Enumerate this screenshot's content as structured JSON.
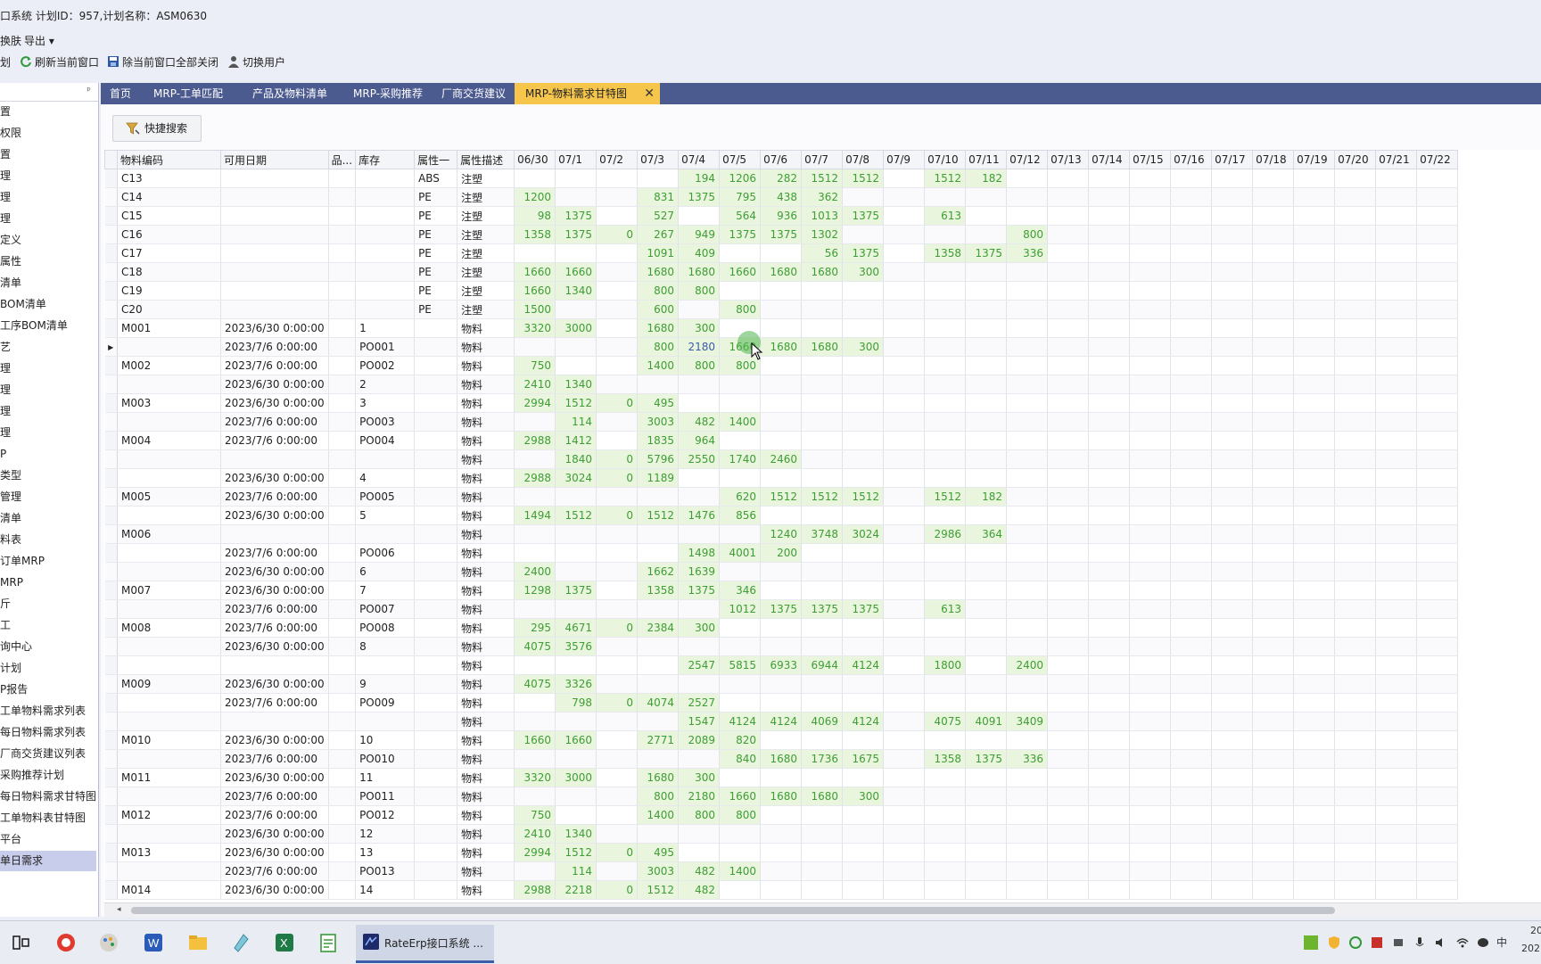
{
  "window": {
    "title": "口系统 计划ID：957,计划名称：ASM0630"
  },
  "menu": [
    "换肤",
    "导出 ▾"
  ],
  "toolbar": [
    {
      "label": "划",
      "icon": ""
    },
    {
      "label": "刷新当前窗口",
      "icon": "refresh-icon"
    },
    {
      "label": "除当前窗口全部关闭",
      "icon": "save-disk-icon"
    },
    {
      "label": "切换用户",
      "icon": "user-icon"
    }
  ],
  "sidebar": {
    "pin": "ᵖ",
    "items": [
      "置",
      "权限",
      "置",
      "理",
      "理",
      "理",
      "定义",
      "属性",
      "清单",
      "BOM清单",
      "工序BOM清单",
      "艺",
      "理",
      "理",
      "理",
      "理",
      "P",
      "类型",
      "管理",
      "清单",
      "料表",
      "订单MRP",
      "MRP",
      "斤",
      "工",
      "询中心",
      "计划",
      "P报告",
      "工单物料需求列表",
      "每日物料需求列表",
      "厂商交货建议列表",
      "采购推荐计划",
      "每日物料需求甘特图",
      "工单物料表甘特图",
      "平台",
      "单日需求"
    ],
    "selected_index": 35
  },
  "tabs": [
    "首页",
    "MRP-工单匹配",
    "产品及物料清单",
    "MRP-采购推荐",
    "厂商交货建议",
    "MRP-物料需求甘特图"
  ],
  "active_tab": 5,
  "quick_search": {
    "label": "快捷搜索"
  },
  "grid": {
    "columns": [
      "物料编码",
      "可用日期",
      "品...",
      "库存",
      "属性一",
      "属性描述",
      "06/30",
      "07/1",
      "07/2",
      "07/3",
      "07/4",
      "07/5",
      "07/6",
      "07/7",
      "07/8",
      "07/9",
      "07/10",
      "07/11",
      "07/12",
      "07/13",
      "07/14",
      "07/15",
      "07/16",
      "07/17",
      "07/18",
      "07/19",
      "07/20",
      "07/21",
      "07/22"
    ],
    "selected_cell": {
      "row": 9,
      "col": "07/4"
    },
    "rows": [
      {
        "code": "C13",
        "date": "",
        "p": "",
        "stock": "",
        "attr": "ABS",
        "desc": "注塑",
        "d": {
          "07/4": "194",
          "07/5": "1206",
          "07/6": "282",
          "07/7": "1512",
          "07/8": "1512",
          "07/10": "1512",
          "07/11": "182"
        }
      },
      {
        "code": "C14",
        "date": "",
        "p": "",
        "stock": "",
        "attr": "PE",
        "desc": "注塑",
        "d": {
          "06/30": "1200",
          "07/3": "831",
          "07/4": "1375",
          "07/5": "795",
          "07/6": "438",
          "07/7": "362"
        }
      },
      {
        "code": "C15",
        "date": "",
        "p": "",
        "stock": "",
        "attr": "PE",
        "desc": "注塑",
        "d": {
          "06/30": "98",
          "07/1": "1375",
          "07/3": "527",
          "07/5": "564",
          "07/6": "936",
          "07/7": "1013",
          "07/8": "1375",
          "07/10": "613"
        }
      },
      {
        "code": "C16",
        "date": "",
        "p": "",
        "stock": "",
        "attr": "PE",
        "desc": "注塑",
        "d": {
          "06/30": "1358",
          "07/1": "1375",
          "07/2": "0",
          "07/3": "267",
          "07/4": "949",
          "07/5": "1375",
          "07/6": "1375",
          "07/7": "1302",
          "07/12": "800"
        }
      },
      {
        "code": "C17",
        "date": "",
        "p": "",
        "stock": "",
        "attr": "PE",
        "desc": "注塑",
        "d": {
          "07/3": "1091",
          "07/4": "409",
          "07/7": "56",
          "07/8": "1375",
          "07/10": "1358",
          "07/11": "1375",
          "07/12": "336"
        }
      },
      {
        "code": "C18",
        "date": "",
        "p": "",
        "stock": "",
        "attr": "PE",
        "desc": "注塑",
        "d": {
          "06/30": "1660",
          "07/1": "1660",
          "07/3": "1680",
          "07/4": "1680",
          "07/5": "1660",
          "07/6": "1680",
          "07/7": "1680",
          "07/8": "300"
        }
      },
      {
        "code": "C19",
        "date": "",
        "p": "",
        "stock": "",
        "attr": "PE",
        "desc": "注塑",
        "d": {
          "06/30": "1660",
          "07/1": "1340",
          "07/3": "800",
          "07/4": "800"
        }
      },
      {
        "code": "C20",
        "date": "",
        "p": "",
        "stock": "",
        "attr": "PE",
        "desc": "注塑",
        "d": {
          "06/30": "1500",
          "07/3": "600",
          "07/5": "800"
        }
      },
      {
        "code": "M001",
        "date": "2023/6/30 0:00:00",
        "p": "",
        "stock": "1",
        "attr": "",
        "desc": "物料",
        "d": {
          "06/30": "3320",
          "07/1": "3000",
          "07/3": "1680",
          "07/4": "300"
        }
      },
      {
        "code": "",
        "date": "2023/7/6 0:00:00",
        "p": "",
        "stock": "PO001",
        "attr": "",
        "desc": "物料",
        "d": {
          "07/3": "800",
          "07/4": "2180",
          "07/5": "1660",
          "07/6": "1680",
          "07/7": "1680",
          "07/8": "300"
        }
      },
      {
        "code": "M002",
        "date": "2023/7/6 0:00:00",
        "p": "",
        "stock": "PO002",
        "attr": "",
        "desc": "物料",
        "d": {
          "06/30": "750",
          "07/3": "1400",
          "07/4": "800",
          "07/5": "800"
        }
      },
      {
        "code": "",
        "date": "2023/6/30 0:00:00",
        "p": "",
        "stock": "2",
        "attr": "",
        "desc": "物料",
        "d": {
          "06/30": "2410",
          "07/1": "1340"
        }
      },
      {
        "code": "M003",
        "date": "2023/6/30 0:00:00",
        "p": "",
        "stock": "3",
        "attr": "",
        "desc": "物料",
        "d": {
          "06/30": "2994",
          "07/1": "1512",
          "07/2": "0",
          "07/3": "495"
        }
      },
      {
        "code": "",
        "date": "2023/7/6 0:00:00",
        "p": "",
        "stock": "PO003",
        "attr": "",
        "desc": "物料",
        "d": {
          "07/1": "114",
          "07/3": "3003",
          "07/4": "482",
          "07/5": "1400"
        }
      },
      {
        "code": "M004",
        "date": "2023/7/6 0:00:00",
        "p": "",
        "stock": "PO004",
        "attr": "",
        "desc": "物料",
        "d": {
          "06/30": "2988",
          "07/1": "1412",
          "07/3": "1835",
          "07/4": "964"
        }
      },
      {
        "code": "",
        "date": "",
        "p": "",
        "stock": "",
        "attr": "",
        "desc": "物料",
        "d": {
          "07/1": "1840",
          "07/2": "0",
          "07/3": "5796",
          "07/4": "2550",
          "07/5": "1740",
          "07/6": "2460"
        }
      },
      {
        "code": "",
        "date": "2023/6/30 0:00:00",
        "p": "",
        "stock": "4",
        "attr": "",
        "desc": "物料",
        "d": {
          "06/30": "2988",
          "07/1": "3024",
          "07/2": "0",
          "07/3": "1189"
        }
      },
      {
        "code": "M005",
        "date": "2023/7/6 0:00:00",
        "p": "",
        "stock": "PO005",
        "attr": "",
        "desc": "物料",
        "d": {
          "07/5": "620",
          "07/6": "1512",
          "07/7": "1512",
          "07/8": "1512",
          "07/10": "1512",
          "07/11": "182"
        }
      },
      {
        "code": "",
        "date": "2023/6/30 0:00:00",
        "p": "",
        "stock": "5",
        "attr": "",
        "desc": "物料",
        "d": {
          "06/30": "1494",
          "07/1": "1512",
          "07/2": "0",
          "07/3": "1512",
          "07/4": "1476",
          "07/5": "856"
        }
      },
      {
        "code": "M006",
        "date": "",
        "p": "",
        "stock": "",
        "attr": "",
        "desc": "物料",
        "d": {
          "07/6": "1240",
          "07/7": "3748",
          "07/8": "3024",
          "07/10": "2986",
          "07/11": "364"
        }
      },
      {
        "code": "",
        "date": "2023/7/6 0:00:00",
        "p": "",
        "stock": "PO006",
        "attr": "",
        "desc": "物料",
        "d": {
          "07/4": "1498",
          "07/5": "4001",
          "07/6": "200"
        }
      },
      {
        "code": "",
        "date": "2023/6/30 0:00:00",
        "p": "",
        "stock": "6",
        "attr": "",
        "desc": "物料",
        "d": {
          "06/30": "2400",
          "07/3": "1662",
          "07/4": "1639"
        }
      },
      {
        "code": "M007",
        "date": "2023/6/30 0:00:00",
        "p": "",
        "stock": "7",
        "attr": "",
        "desc": "物料",
        "d": {
          "06/30": "1298",
          "07/1": "1375",
          "07/3": "1358",
          "07/4": "1375",
          "07/5": "346"
        }
      },
      {
        "code": "",
        "date": "2023/7/6 0:00:00",
        "p": "",
        "stock": "PO007",
        "attr": "",
        "desc": "物料",
        "d": {
          "07/5": "1012",
          "07/6": "1375",
          "07/7": "1375",
          "07/8": "1375",
          "07/10": "613"
        }
      },
      {
        "code": "M008",
        "date": "2023/7/6 0:00:00",
        "p": "",
        "stock": "PO008",
        "attr": "",
        "desc": "物料",
        "d": {
          "06/30": "295",
          "07/1": "4671",
          "07/2": "0",
          "07/3": "2384",
          "07/4": "300"
        }
      },
      {
        "code": "",
        "date": "2023/6/30 0:00:00",
        "p": "",
        "stock": "8",
        "attr": "",
        "desc": "物料",
        "d": {
          "06/30": "4075",
          "07/1": "3576"
        }
      },
      {
        "code": "",
        "date": "",
        "p": "",
        "stock": "",
        "attr": "",
        "desc": "物料",
        "d": {
          "07/4": "2547",
          "07/5": "5815",
          "07/6": "6933",
          "07/7": "6944",
          "07/8": "4124",
          "07/10": "1800",
          "07/12": "2400"
        }
      },
      {
        "code": "M009",
        "date": "2023/6/30 0:00:00",
        "p": "",
        "stock": "9",
        "attr": "",
        "desc": "物料",
        "d": {
          "06/30": "4075",
          "07/1": "3326"
        }
      },
      {
        "code": "",
        "date": "2023/7/6 0:00:00",
        "p": "",
        "stock": "PO009",
        "attr": "",
        "desc": "物料",
        "d": {
          "07/1": "798",
          "07/2": "0",
          "07/3": "4074",
          "07/4": "2527"
        }
      },
      {
        "code": "",
        "date": "",
        "p": "",
        "stock": "",
        "attr": "",
        "desc": "物料",
        "d": {
          "07/4": "1547",
          "07/5": "4124",
          "07/6": "4124",
          "07/7": "4069",
          "07/8": "4124",
          "07/10": "4075",
          "07/11": "4091",
          "07/12": "3409"
        }
      },
      {
        "code": "M010",
        "date": "2023/6/30 0:00:00",
        "p": "",
        "stock": "10",
        "attr": "",
        "desc": "物料",
        "d": {
          "06/30": "1660",
          "07/1": "1660",
          "07/3": "2771",
          "07/4": "2089",
          "07/5": "820"
        }
      },
      {
        "code": "",
        "date": "2023/7/6 0:00:00",
        "p": "",
        "stock": "PO010",
        "attr": "",
        "desc": "物料",
        "d": {
          "07/5": "840",
          "07/6": "1680",
          "07/7": "1736",
          "07/8": "1675",
          "07/10": "1358",
          "07/11": "1375",
          "07/12": "336"
        }
      },
      {
        "code": "M011",
        "date": "2023/6/30 0:00:00",
        "p": "",
        "stock": "11",
        "attr": "",
        "desc": "物料",
        "d": {
          "06/30": "3320",
          "07/1": "3000",
          "07/3": "1680",
          "07/4": "300"
        }
      },
      {
        "code": "",
        "date": "2023/7/6 0:00:00",
        "p": "",
        "stock": "PO011",
        "attr": "",
        "desc": "物料",
        "d": {
          "07/3": "800",
          "07/4": "2180",
          "07/5": "1660",
          "07/6": "1680",
          "07/7": "1680",
          "07/8": "300"
        }
      },
      {
        "code": "M012",
        "date": "2023/7/6 0:00:00",
        "p": "",
        "stock": "PO012",
        "attr": "",
        "desc": "物料",
        "d": {
          "06/30": "750",
          "07/3": "1400",
          "07/4": "800",
          "07/5": "800"
        }
      },
      {
        "code": "",
        "date": "2023/6/30 0:00:00",
        "p": "",
        "stock": "12",
        "attr": "",
        "desc": "物料",
        "d": {
          "06/30": "2410",
          "07/1": "1340"
        }
      },
      {
        "code": "M013",
        "date": "2023/6/30 0:00:00",
        "p": "",
        "stock": "13",
        "attr": "",
        "desc": "物料",
        "d": {
          "06/30": "2994",
          "07/1": "1512",
          "07/2": "0",
          "07/3": "495"
        }
      },
      {
        "code": "",
        "date": "2023/7/6 0:00:00",
        "p": "",
        "stock": "PO013",
        "attr": "",
        "desc": "物料",
        "d": {
          "07/1": "114",
          "07/3": "3003",
          "07/4": "482",
          "07/5": "1400"
        }
      },
      {
        "code": "M014",
        "date": "2023/6/30 0:00:00",
        "p": "",
        "stock": "14",
        "attr": "",
        "desc": "物料",
        "d": {
          "06/30": "2988",
          "07/1": "2218",
          "07/2": "0",
          "07/3": "1512",
          "07/4": "482"
        }
      }
    ]
  },
  "taskbar": {
    "app_label": "RateErp接口系统 ...",
    "icons": [
      "task-view-icon",
      "netease-icon",
      "paint-icon",
      "word-icon",
      "file-explorer-icon",
      "notepad-icon",
      "excel-icon",
      "editor-icon"
    ],
    "tray": [
      "^",
      "中"
    ],
    "clock_fragments": [
      "20",
      "202"
    ]
  },
  "colors": {
    "accent_tab": "#f6c64c",
    "tabbar": "#4b5a8f",
    "value_green": "#3e9d34",
    "value_fill": "#e9f6dd"
  }
}
